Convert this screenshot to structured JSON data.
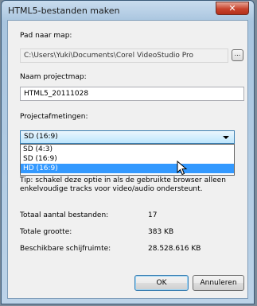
{
  "window": {
    "title": "HTML5-bestanden maken",
    "close_glyph": "✕"
  },
  "path": {
    "label": "Pad naar map:",
    "value": "C:\\Users\\Yuki\\Documents\\Corel VideoStudio Pro",
    "browse_label": "..."
  },
  "project_folder": {
    "label": "Naam projectmap:",
    "value": "HTML5_20111028"
  },
  "dimensions": {
    "label": "Projectafmetingen:",
    "selected": "SD (16:9)",
    "options": [
      {
        "label": "SD (4:3)",
        "highlighted": false
      },
      {
        "label": "SD (16:9)",
        "highlighted": false
      },
      {
        "label": "HD (16:9)",
        "highlighted": true
      }
    ]
  },
  "tip": "Tip: schakel deze optie in als de gebruikte browser alleen enkelvoudige tracks voor video/audio ondersteunt.",
  "stats": [
    {
      "label": "Totaal aantal bestanden:",
      "value": "17"
    },
    {
      "label": "Totale grootte:",
      "value": "383 KB"
    },
    {
      "label": "Beschikbare schijfruimte:",
      "value": "28.528.616 KB"
    }
  ],
  "buttons": {
    "ok": "OK",
    "cancel": "Annuleren"
  },
  "colors": {
    "selection": "#3399ff",
    "close_button": "#c8432d"
  },
  "icons": {
    "close": "close-icon",
    "dropdown": "chevron-down-icon",
    "cursor": "mouse-pointer-icon"
  }
}
